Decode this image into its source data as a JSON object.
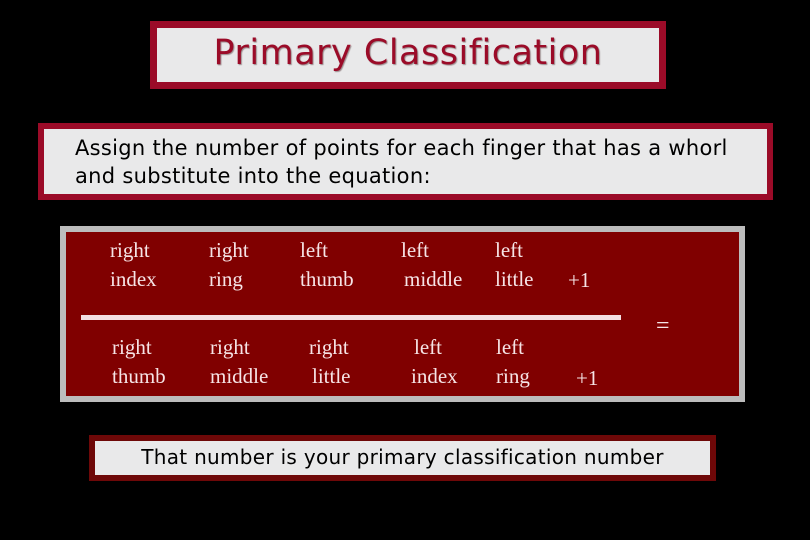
{
  "title": "Primary Classification",
  "instruction": "Assign the number of points for each finger that has a whorl and substitute into the equation:",
  "equation": {
    "numerator": [
      {
        "line1": "right",
        "line2": "index"
      },
      {
        "line1": "right",
        "line2": "ring"
      },
      {
        "line1": "left",
        "line2": "thumb"
      },
      {
        "line1": "left",
        "line2": "middle"
      },
      {
        "line1": "left",
        "line2": "little"
      }
    ],
    "numerator_addend": "+1",
    "denominator": [
      {
        "line1": "right",
        "line2": "thumb"
      },
      {
        "line1": "right",
        "line2": "middle"
      },
      {
        "line1": "right",
        "line2": "little"
      },
      {
        "line1": "left",
        "line2": "index"
      },
      {
        "line1": "left",
        "line2": "ring"
      }
    ],
    "denominator_addend": "+1",
    "equals_sign": "="
  },
  "result_text": "That number is your primary classification number",
  "colors": {
    "background": "#000000",
    "title_border": "#9b0b28",
    "title_text": "#9b0b28",
    "panel_fill": "#e9e9ea",
    "equation_fill": "#800000",
    "equation_border": "#bcbcbc",
    "equation_text": "#f6e4e6",
    "result_border": "#6e0808"
  }
}
